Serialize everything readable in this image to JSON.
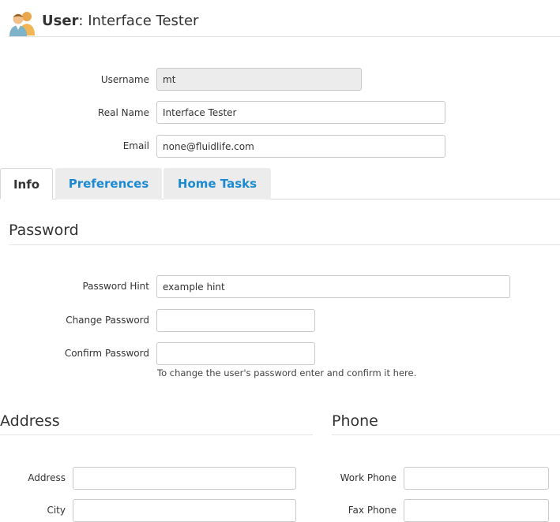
{
  "header": {
    "title_prefix": "User",
    "title_name": ": Interface Tester"
  },
  "account": {
    "username_label": "Username",
    "username_value": "mt",
    "realname_label": "Real Name",
    "realname_value": "Interface Tester",
    "email_label": "Email",
    "email_value": "none@fluidlife.com"
  },
  "tabs": [
    {
      "label": "Info"
    },
    {
      "label": "Preferences"
    },
    {
      "label": "Home Tasks"
    }
  ],
  "password": {
    "title": "Password",
    "hint_label": "Password Hint",
    "hint_value": "example hint",
    "change_label": "Change Password",
    "change_value": "",
    "confirm_label": "Confirm Password",
    "confirm_value": "",
    "help_text": "To change the user's password enter and confirm it here."
  },
  "address": {
    "title": "Address",
    "address_label": "Address",
    "address_value": "",
    "city_label": "City",
    "city_value": ""
  },
  "phone": {
    "title": "Phone",
    "work_label": "Work Phone",
    "work_value": "",
    "fax_label": "Fax Phone",
    "fax_value": ""
  },
  "colors": {
    "link": "#1b8ad1",
    "tab_inactive_bg": "#ececec",
    "readonly_bg": "#ececec"
  }
}
